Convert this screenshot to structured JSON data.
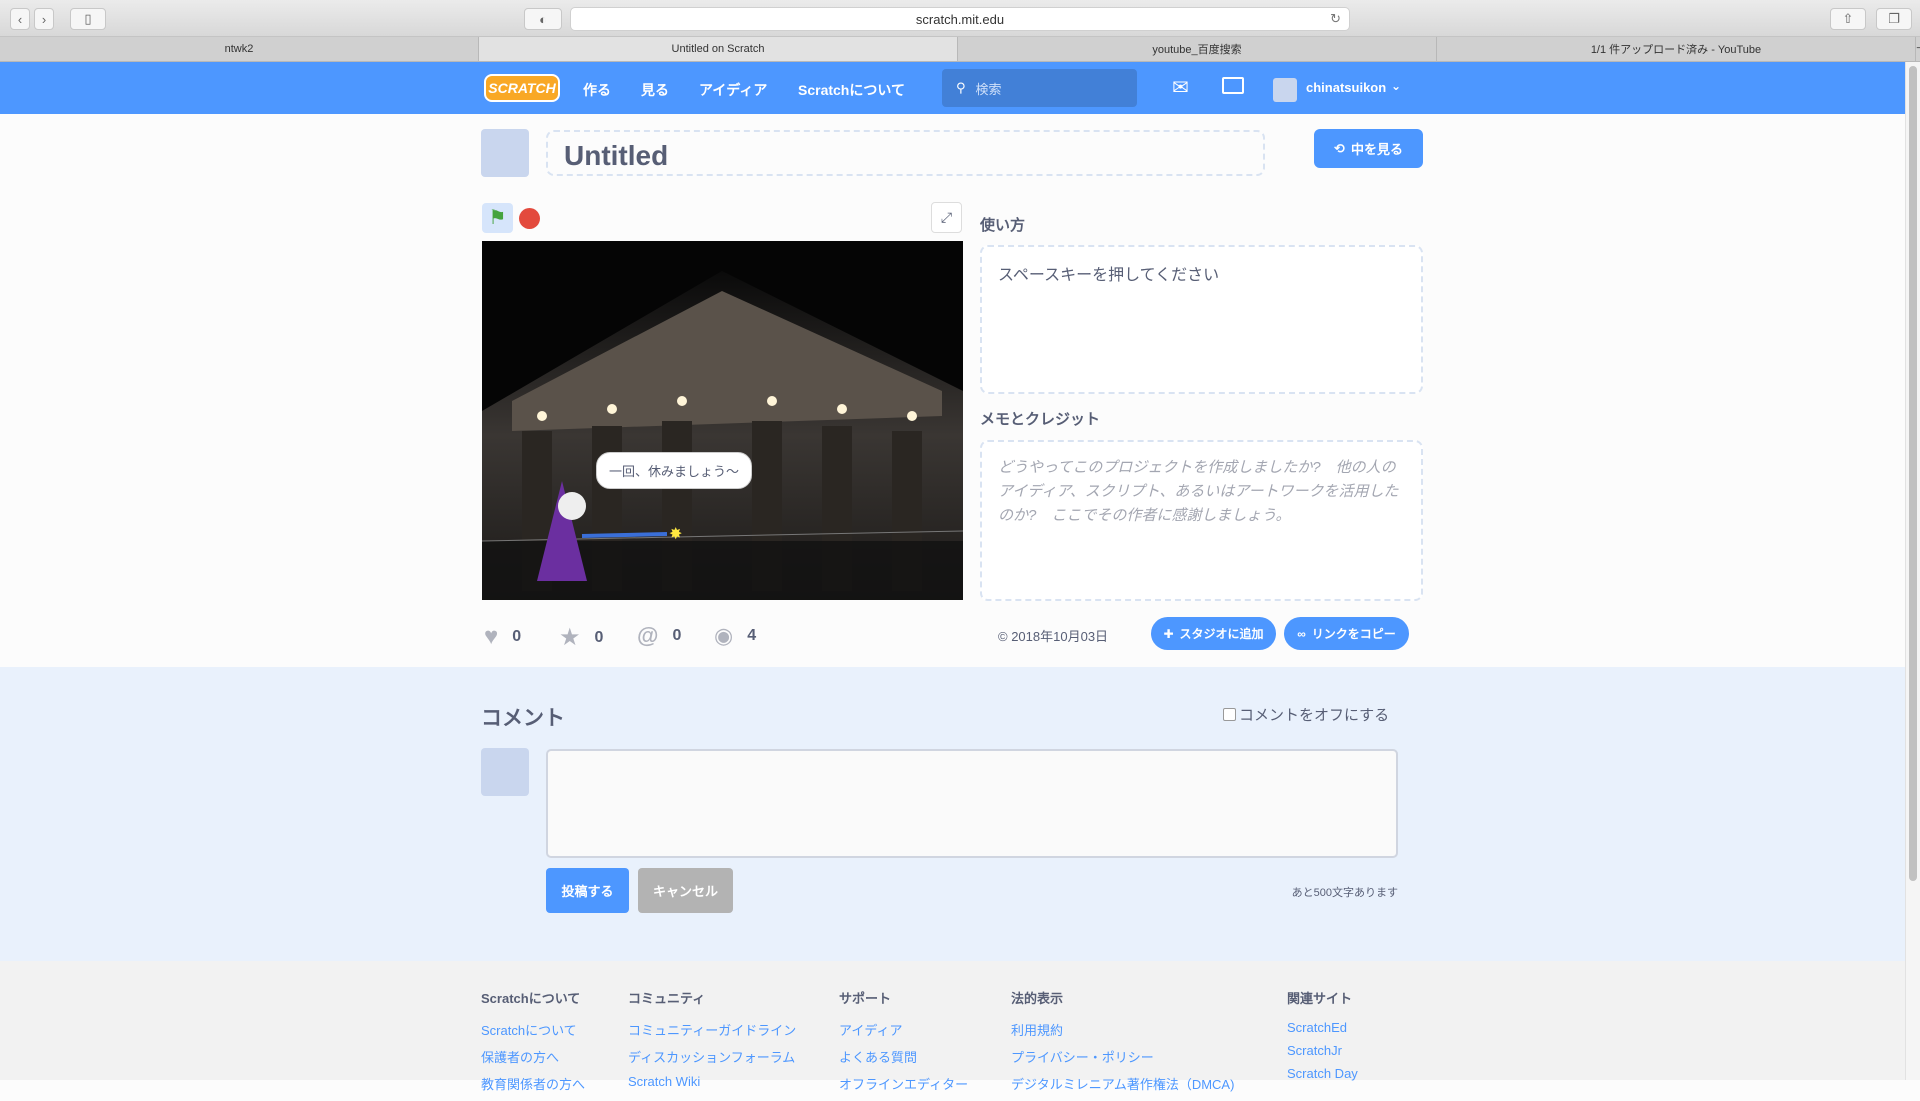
{
  "browser": {
    "url": "scratch.mit.edu",
    "tabs": [
      {
        "label": "ntwk2"
      },
      {
        "label": "Untitled on Scratch"
      },
      {
        "label": "youtube_百度搜索"
      },
      {
        "label": "1/1 件アップロード済み - YouTube"
      }
    ]
  },
  "nav": {
    "logo": "SCRATCH",
    "items": [
      "作る",
      "見る",
      "アイディア",
      "Scratchについて"
    ],
    "search_placeholder": "検索",
    "username": "chinatsuikon"
  },
  "project": {
    "title": "Untitled",
    "see_inside": "中を見る",
    "instructions_label": "使い方",
    "instructions": "スペースキーを押してください",
    "notes_label": "メモとクレジット",
    "notes_placeholder": "どうやってこのプロジェクトを作成しましたか?　他の人のアイディア、スクリプト、あるいはアートワークを活用したのか?　ここでその作者に感謝しましょう。",
    "speech_bubble": "一回、休みましょう〜"
  },
  "stats": {
    "loves": "0",
    "favorites": "0",
    "remixes": "0",
    "views": "4",
    "date": "2018年10月03日",
    "add_to_studio": "スタジオに追加",
    "copy_link": "リンクをコピー"
  },
  "comments": {
    "title": "コメント",
    "turn_off": "コメントをオフにする",
    "post": "投稿する",
    "cancel": "キャンセル",
    "remaining": "あと500文字あります"
  },
  "footer": {
    "columns": [
      {
        "title": "Scratchについて",
        "links": [
          "Scratchについて",
          "保護者の方へ",
          "教育関係者の方へ"
        ]
      },
      {
        "title": "コミュニティ",
        "links": [
          "コミュニティーガイドライン",
          "ディスカッションフォーラム",
          "Scratch Wiki"
        ]
      },
      {
        "title": "サポート",
        "links": [
          "アイディア",
          "よくある質問",
          "オフラインエディター"
        ]
      },
      {
        "title": "法的表示",
        "links": [
          "利用規約",
          "プライバシー・ポリシー",
          "デジタルミレニアム著作権法（DMCA)"
        ]
      },
      {
        "title": "関連サイト",
        "links": [
          "ScratchEd",
          "ScratchJr",
          "Scratch Day"
        ]
      }
    ]
  },
  "colors": {
    "brand": "#4d97ff",
    "comments_bg": "#e9f1fc"
  }
}
